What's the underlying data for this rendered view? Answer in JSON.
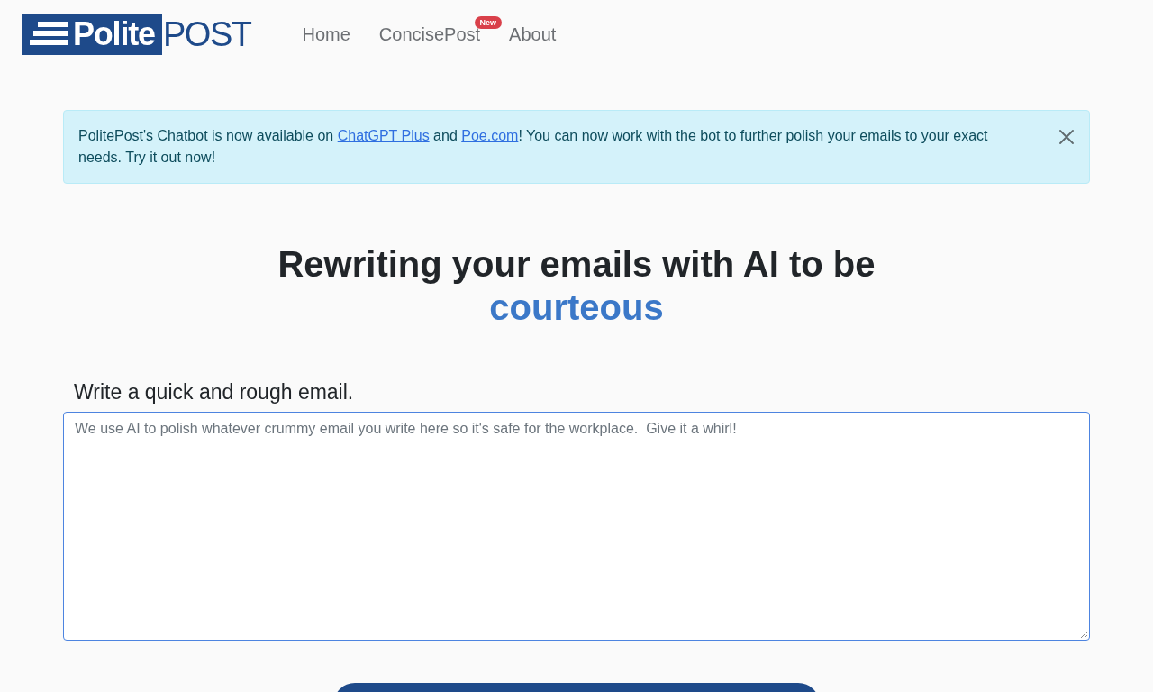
{
  "header": {
    "logo": {
      "part_1": "Polite",
      "part_2": "POST"
    },
    "nav": [
      {
        "label": "Home"
      },
      {
        "label": "ConcisePost",
        "badge": "New"
      },
      {
        "label": "About"
      }
    ]
  },
  "alert": {
    "message": [
      {
        "kind": "text",
        "text": "PolitePost's Chatbot is now available on "
      },
      {
        "kind": "link",
        "text": "ChatGPT Plus"
      },
      {
        "kind": "text",
        "text": " and "
      },
      {
        "kind": "link",
        "text": "Poe.com"
      },
      {
        "kind": "text",
        "text": "! You can now work with the bot to further polish your emails to your exact needs. Try it out now!"
      }
    ]
  },
  "hero": {
    "title": "Rewriting your emails with AI to be",
    "highlight": "courteous"
  },
  "form": {
    "label": "Write a quick and rough email.",
    "placeholder": "We use AI to polish whatever crummy email you write here so it's safe for the workplace.  Give it a whirl!",
    "focused": true
  }
}
